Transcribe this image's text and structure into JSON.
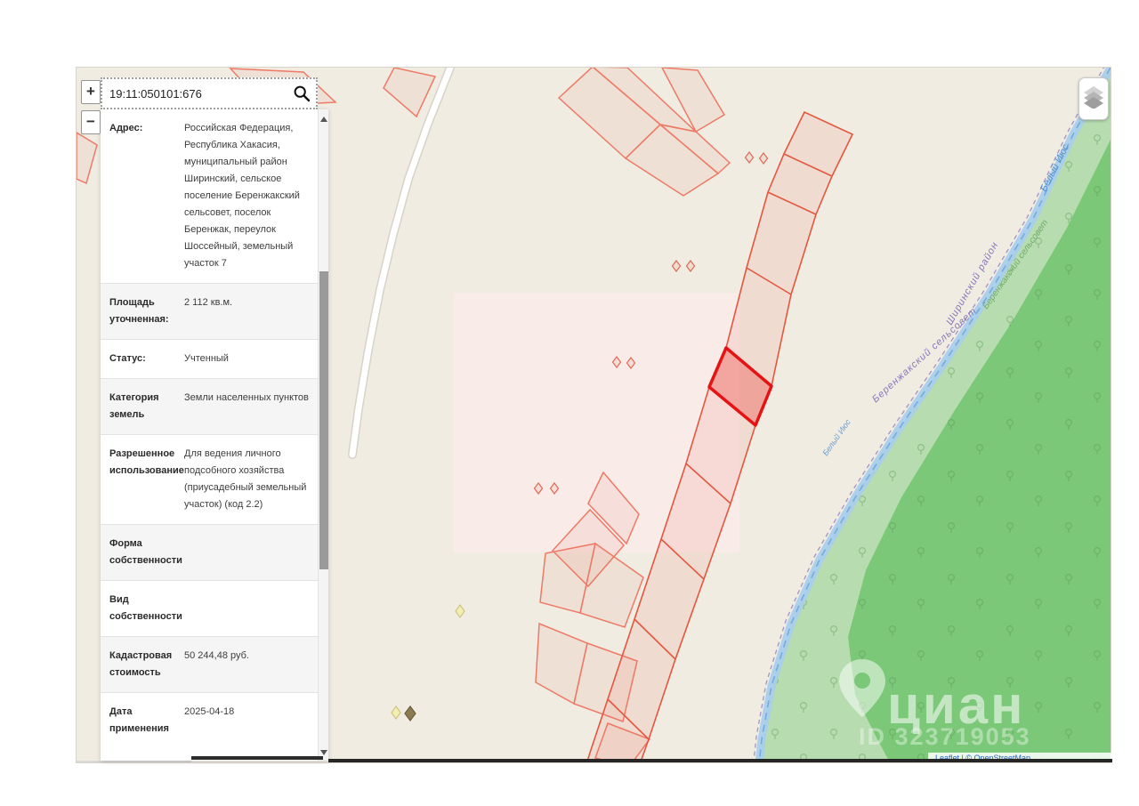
{
  "search": {
    "value": "19:11:050101:676",
    "icon": "search-icon"
  },
  "zoom_controls": {
    "zoom_in_label": "+",
    "zoom_out_label": "−"
  },
  "layers_control": {
    "icon": "layers-icon"
  },
  "panel": {
    "rows": [
      {
        "label": "Адрес:",
        "value": "Российская Федерация, Республика Хакасия, муниципальный район Ширинский, сельское поселение Беренжакский сельсовет, поселок Беренжак, переулок Шоссейный, земельный участок 7"
      },
      {
        "label": "Площадь уточненная:",
        "value": "2 112 кв.м."
      },
      {
        "label": "Статус:",
        "value": "Учтенный"
      },
      {
        "label": "Категория земель",
        "value": "Земли населенных пунктов"
      },
      {
        "label": "Разрешенное использование",
        "value": "Для ведения личного подсобного хозяйства (приусадебный земельный участок) (код 2.2)"
      },
      {
        "label": "Форма собственности",
        "value": ""
      },
      {
        "label": "Вид собственности",
        "value": ""
      },
      {
        "label": "Кадастровая стоимость",
        "value": "50 244,48 руб."
      },
      {
        "label": "Дата применения",
        "value": "2025-04-18"
      }
    ]
  },
  "map": {
    "labels": {
      "selsovet": "Беренжакский сельсовет",
      "district": "Ширинский район",
      "river": "Белый Июс",
      "river_small": "Белый Июс",
      "selsovet_green": "Беренжакский сельсовет"
    },
    "watermark": {
      "brand": "циан",
      "id": "ID 323719053"
    },
    "attribution": "Leaflet | © OpenStreetMap"
  },
  "colors": {
    "map_background": "#f0ece2",
    "parcel_stroke": "#ee7a66",
    "selected_parcel_stroke": "#e51313",
    "green_light": "#b7dcb0",
    "green_dark": "#7cc879",
    "river_blue": "#a9cfec",
    "label_purple": "#8678bb",
    "label_blue": "#5592cc"
  }
}
